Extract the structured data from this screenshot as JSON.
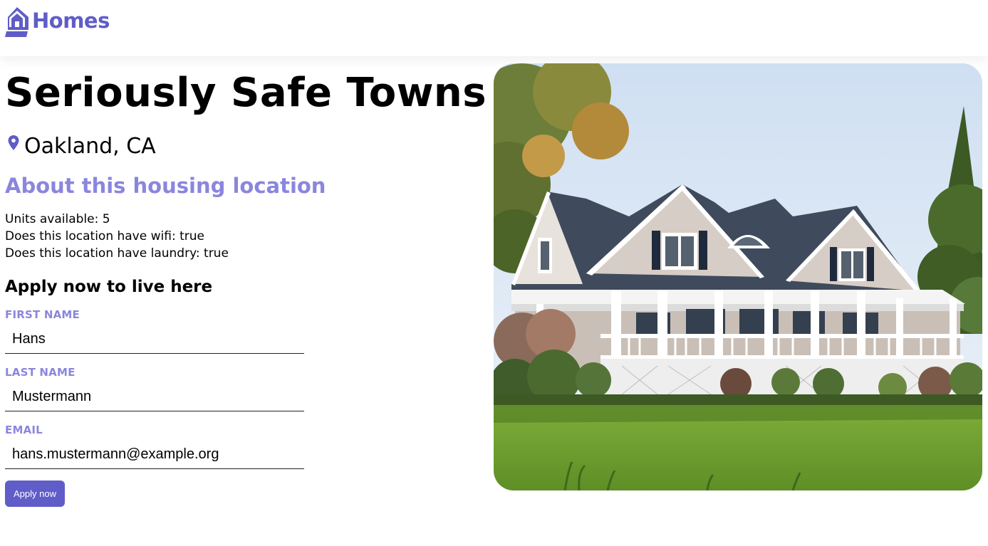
{
  "header": {
    "brand_text": "Homes",
    "brand_icon": "house-icon",
    "accent_color": "#605dc8"
  },
  "listing": {
    "name": "Seriously Safe Towns",
    "location_icon": "location-pin-icon",
    "location": "Oakland, CA",
    "photo": "house-photo"
  },
  "about": {
    "heading": "About this housing location",
    "units": "Units available: 5",
    "wifi": "Does this location have wifi: true",
    "laundry": "Does this location have laundry: true"
  },
  "form": {
    "heading": "Apply now to live here",
    "first_name_label": "FIRST NAME",
    "first_name_value": "Hans",
    "last_name_label": "LAST NAME",
    "last_name_value": "Mustermann",
    "email_label": "EMAIL",
    "email_value": "hans.mustermann@example.org",
    "submit_label": "Apply now",
    "label_color": "#8a86de"
  }
}
